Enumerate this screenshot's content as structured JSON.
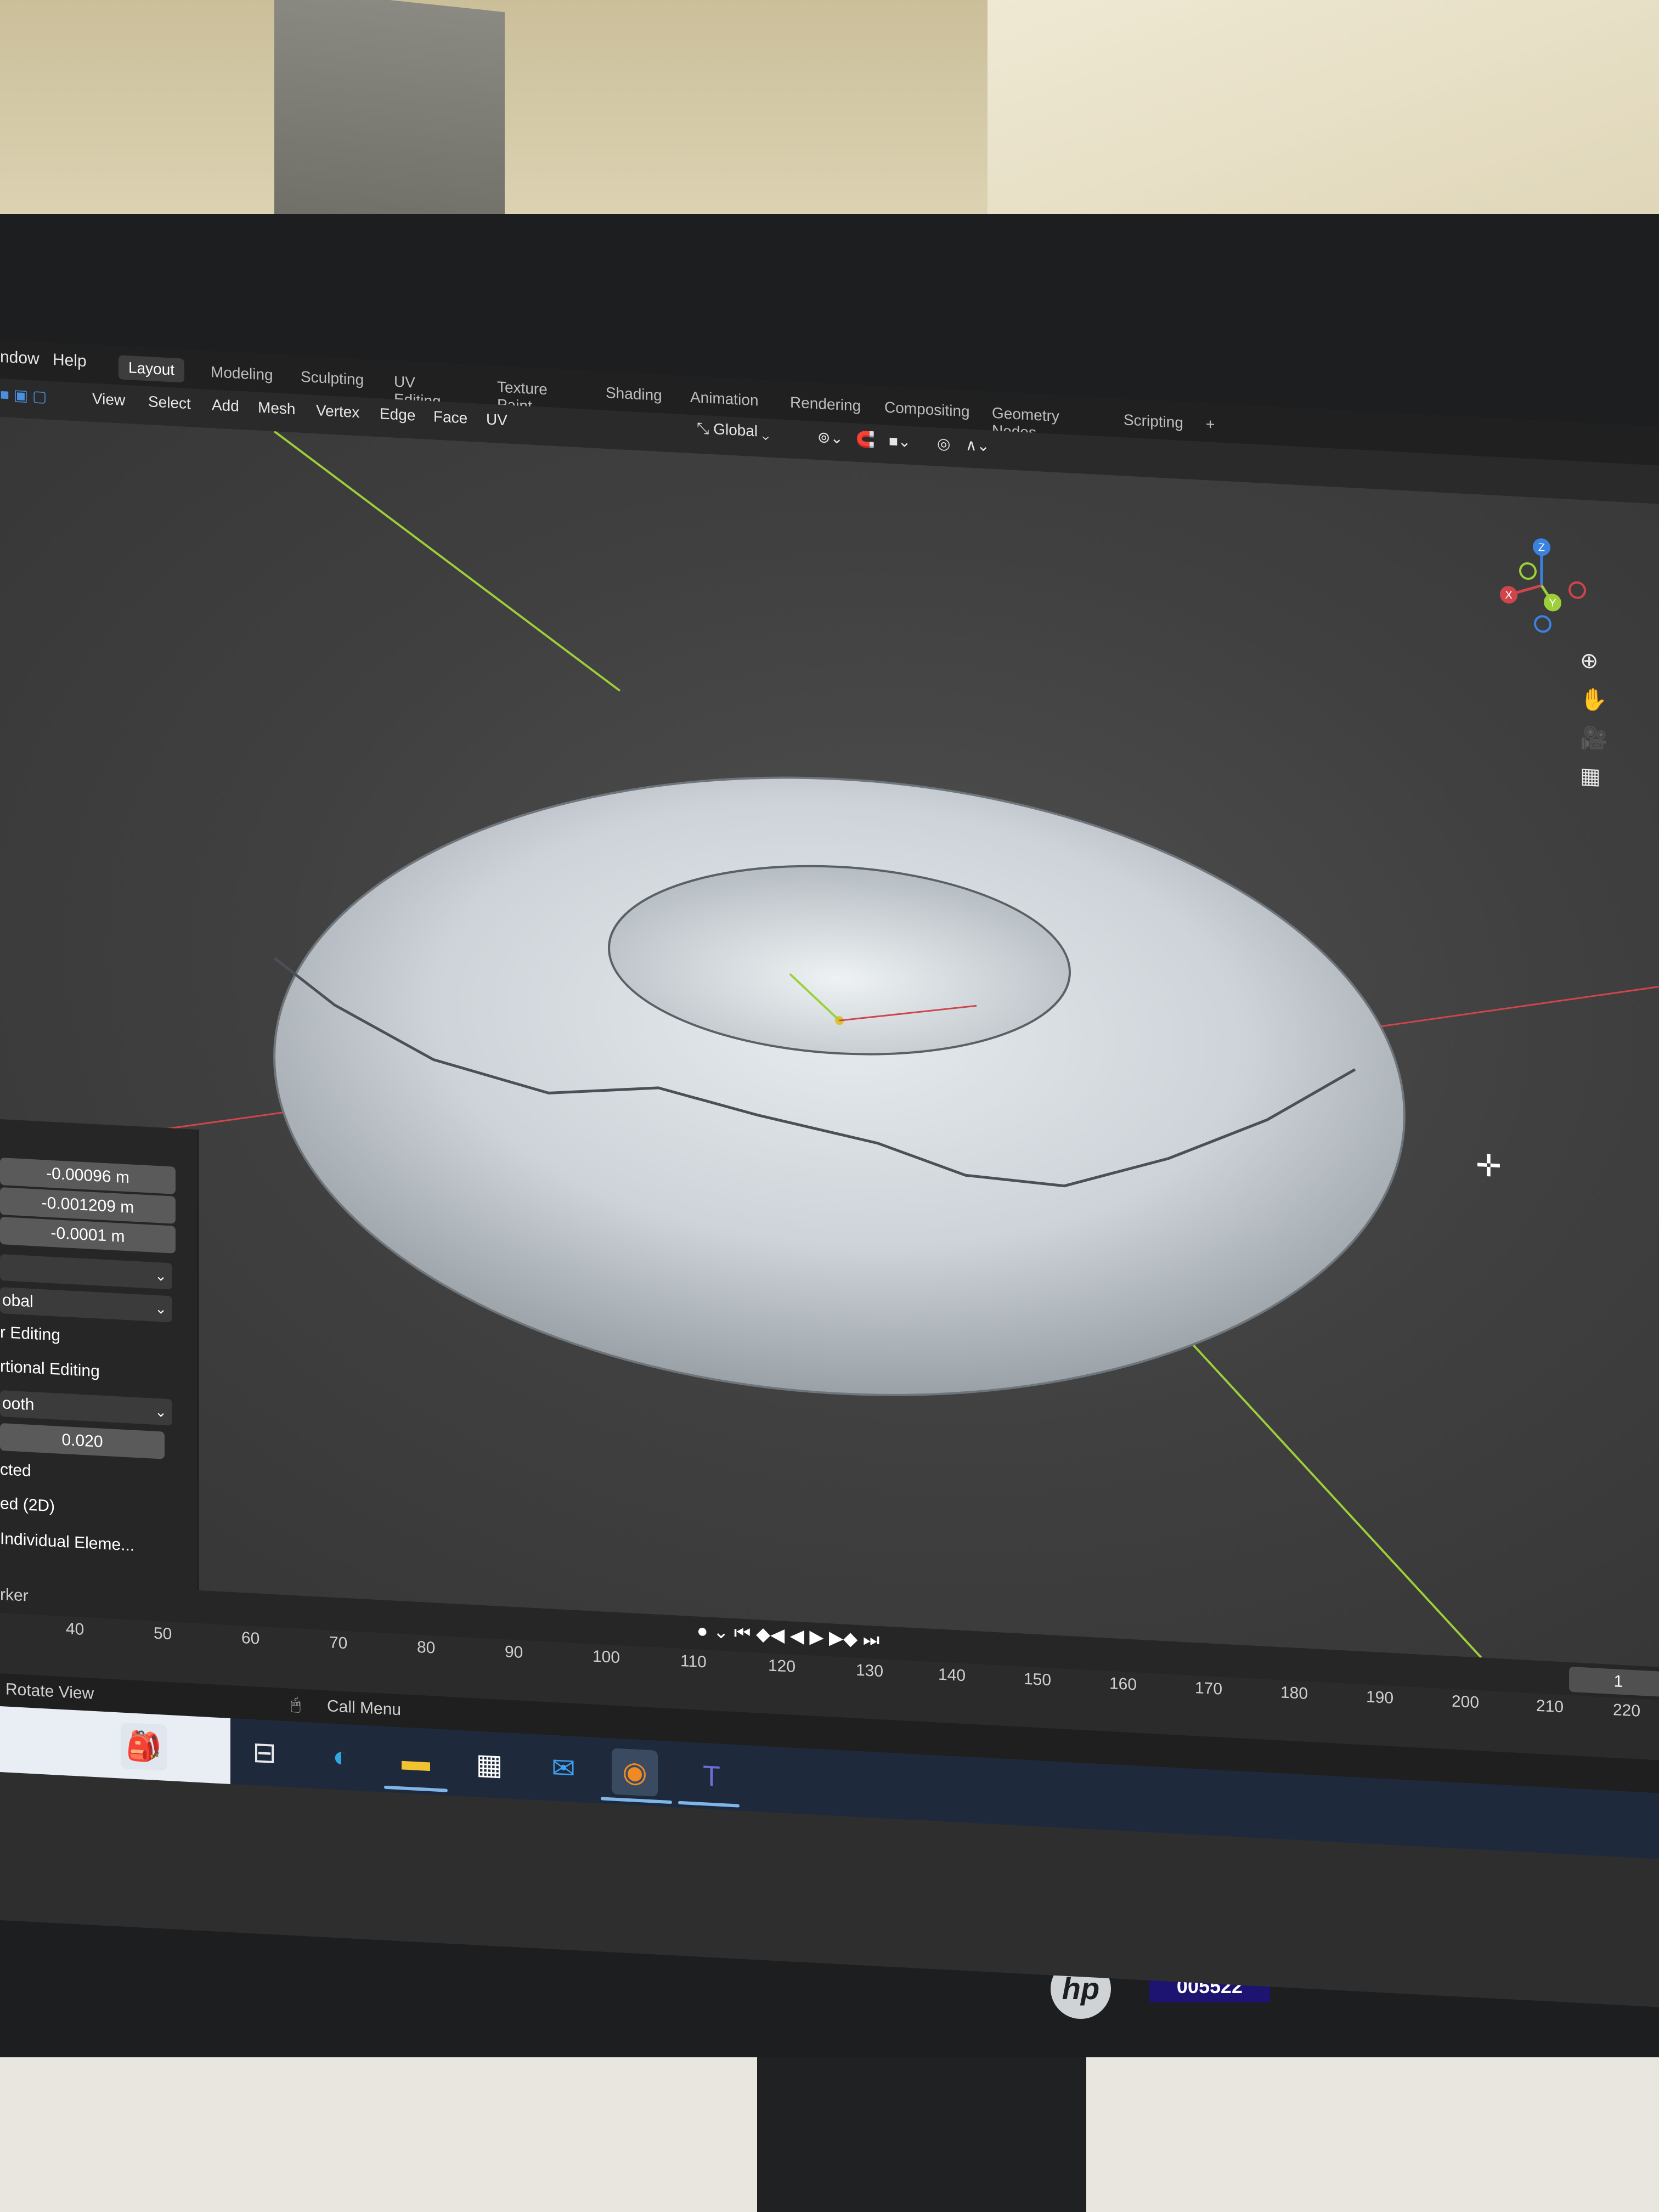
{
  "menubar": {
    "window_label": "ndow",
    "help_label": "Help"
  },
  "workspaces": [
    "Layout",
    "Modeling",
    "Sculpting",
    "UV Editing",
    "Texture Paint",
    "Shading",
    "Animation",
    "Rendering",
    "Compositing",
    "Geometry Nodes",
    "Scripting"
  ],
  "workspace_add": "+",
  "edit_menus": [
    "View",
    "Select",
    "Add",
    "Mesh",
    "Vertex",
    "Edge",
    "Face",
    "UV"
  ],
  "transform_orientation": "Global",
  "redo_panel": {
    "values": [
      "-0.00096 m",
      "-0.001209 m",
      "-0.0001 m"
    ],
    "orientation": "obal",
    "editing_option_1": "r Editing",
    "editing_option_2": "rtional Editing",
    "falloff": "ooth",
    "proportional_size": "0.020",
    "connected_only": "cted",
    "projected_2d": "ed (2D)",
    "individual_elements": "Individual Eleme..."
  },
  "timeline": {
    "marker_label": "rker",
    "ticks": [
      "40",
      "50",
      "60",
      "70",
      "80",
      "90",
      "100",
      "110",
      "120",
      "130",
      "140",
      "150",
      "160",
      "170",
      "180",
      "190",
      "200",
      "210",
      "220"
    ],
    "current_frame": "1"
  },
  "statusbar": {
    "rotate_view": "Rotate View",
    "call_menu": "Call Menu"
  },
  "taskbar_icons": [
    "widgets-icon",
    "task-view-icon",
    "edge-browser-icon",
    "file-explorer-icon",
    "store-icon",
    "mail-icon",
    "blender-icon",
    "teams-icon"
  ],
  "bezel": {
    "brand": "hp",
    "asset_tag": "005522"
  },
  "colors": {
    "axis_x": "#d0454c",
    "axis_y": "#9ccf3a",
    "axis_z": "#3a82e0",
    "viewport_bg": "#404040",
    "taskbar_bg": "#1e2a3c"
  }
}
